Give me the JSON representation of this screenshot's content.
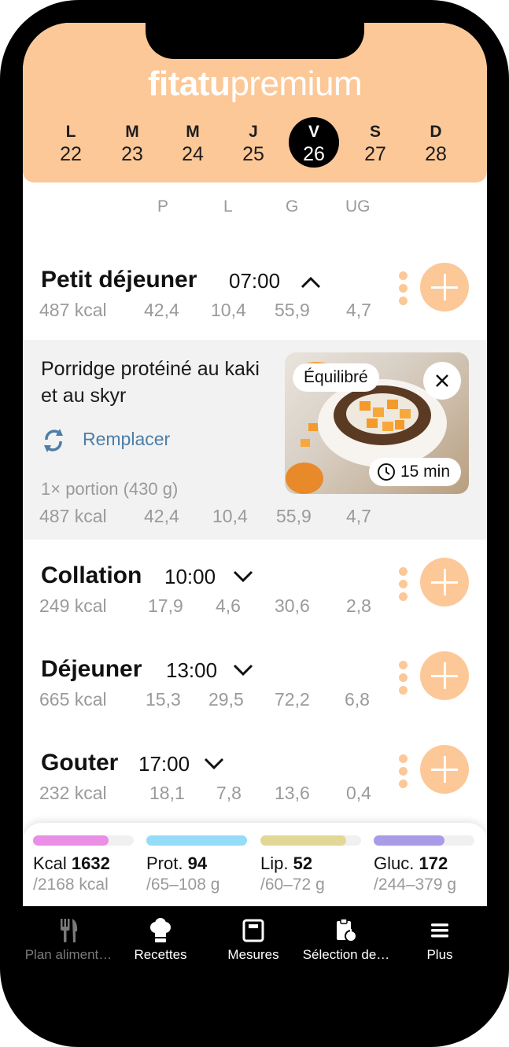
{
  "brand": {
    "part1": "fitatu",
    "part2": "premium"
  },
  "week": [
    {
      "letter": "L",
      "num": "22",
      "selected": false
    },
    {
      "letter": "M",
      "num": "23",
      "selected": false
    },
    {
      "letter": "M",
      "num": "24",
      "selected": false
    },
    {
      "letter": "J",
      "num": "25",
      "selected": false
    },
    {
      "letter": "V",
      "num": "26",
      "selected": true
    },
    {
      "letter": "S",
      "num": "27",
      "selected": false
    },
    {
      "letter": "D",
      "num": "28",
      "selected": false
    }
  ],
  "macro_headers": [
    "P",
    "L",
    "G",
    "UG"
  ],
  "meals": [
    {
      "title": "Petit déjeuner",
      "time": "07:00",
      "expanded": true,
      "kcal": "487 kcal",
      "p": "42,4",
      "l": "10,4",
      "g": "55,9",
      "ug": "4,7"
    },
    {
      "title": "Collation",
      "time": "10:00",
      "expanded": false,
      "kcal": "249 kcal",
      "p": "17,9",
      "l": "4,6",
      "g": "30,6",
      "ug": "2,8"
    },
    {
      "title": "Déjeuner",
      "time": "13:00",
      "expanded": false,
      "kcal": "665 kcal",
      "p": "15,3",
      "l": "29,5",
      "g": "72,2",
      "ug": "6,8"
    },
    {
      "title": "Gouter",
      "time": "17:00",
      "expanded": false,
      "kcal": "232 kcal",
      "p": "18,1",
      "l": "7,8",
      "g": "13,6",
      "ug": "0,4"
    }
  ],
  "recipe": {
    "name": "Porridge protéiné au kaki et au skyr",
    "replace_label": "Remplacer",
    "portion": "1× portion (430 g)",
    "kcal": "487 kcal",
    "p": "42,4",
    "l": "10,4",
    "g": "55,9",
    "ug": "4,7",
    "tag": "Équilibré",
    "duration": "15 min"
  },
  "summary": [
    {
      "label": "Kcal",
      "value": "1632",
      "range": "/2168 kcal",
      "color": "#e98fe6",
      "fill": 0.75
    },
    {
      "label": "Prot.",
      "value": "94",
      "range": "/65–108 g",
      "color": "#94dcf8",
      "fill": 1.0
    },
    {
      "label": "Lip.",
      "value": "52",
      "range": "/60–72 g",
      "color": "#e3d796",
      "fill": 0.85
    },
    {
      "label": "Gluc.",
      "value": "172",
      "range": "/244–379 g",
      "color": "#a99be6",
      "fill": 0.7
    }
  ],
  "tabs": [
    {
      "label": "Plan aliment…",
      "icon": "fork-knife-icon",
      "active": false
    },
    {
      "label": "Recettes",
      "icon": "chef-hat-icon",
      "active": true
    },
    {
      "label": "Mesures",
      "icon": "scale-icon",
      "active": true
    },
    {
      "label": "Sélection de…",
      "icon": "clipboard-apple-icon",
      "active": true
    },
    {
      "label": "Plus",
      "icon": "menu-icon",
      "active": true
    }
  ]
}
